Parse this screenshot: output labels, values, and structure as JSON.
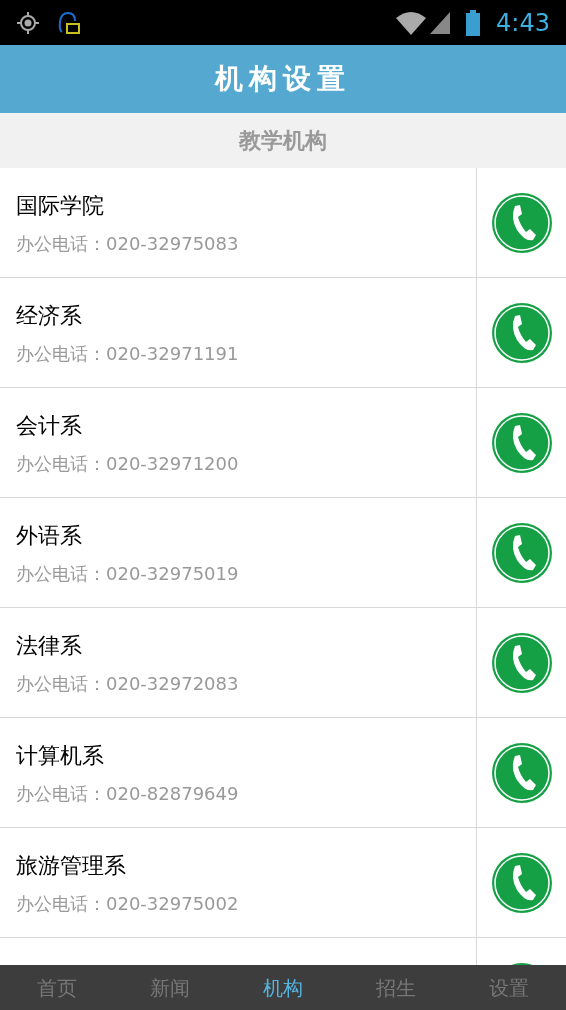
{
  "status_bar": {
    "time": "4:43"
  },
  "header": {
    "title": "机构设置"
  },
  "section": {
    "title": "教学机构"
  },
  "contacts": [
    {
      "name": "国际学院",
      "phone": "办公电话：020-32975083"
    },
    {
      "name": "经济系",
      "phone": "办公电话：020-32971191"
    },
    {
      "name": "会计系",
      "phone": "办公电话：020-32971200"
    },
    {
      "name": "外语系",
      "phone": "办公电话：020-32975019"
    },
    {
      "name": "法律系",
      "phone": "办公电话：020-32972083"
    },
    {
      "name": "计算机系",
      "phone": "办公电话：020-82879649"
    },
    {
      "name": "旅游管理系",
      "phone": "办公电话：020-32975002"
    }
  ],
  "tabs": [
    {
      "label": "首页",
      "selected": false
    },
    {
      "label": "新闻",
      "selected": false
    },
    {
      "label": "机构",
      "selected": true
    },
    {
      "label": "招生",
      "selected": false
    },
    {
      "label": "设置",
      "selected": false
    }
  ]
}
